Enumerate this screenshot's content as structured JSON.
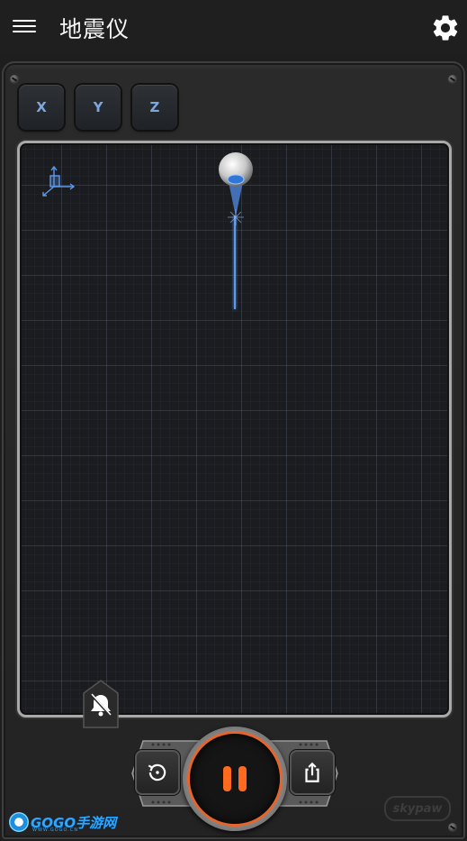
{
  "app": {
    "title": "地震仪",
    "menu_icon": "hamburger-menu-icon",
    "settings_icon": "gear-icon"
  },
  "axis_buttons": [
    {
      "label": "X"
    },
    {
      "label": "Y"
    },
    {
      "label": "Z"
    }
  ],
  "controls": {
    "reset_icon": "reset-history-icon",
    "pause_icon": "pause-icon",
    "share_icon": "share-icon",
    "mute_icon": "bell-off-icon"
  },
  "branding": {
    "device_logo": "skypaw",
    "watermark": "GOGO手游网",
    "watermark_sub": "WWW.GOGO.CN"
  },
  "colors": {
    "accent_orange": "#ff6a1f",
    "trace_blue": "#5b9bef",
    "axis_label_blue": "#7ea6e0"
  }
}
